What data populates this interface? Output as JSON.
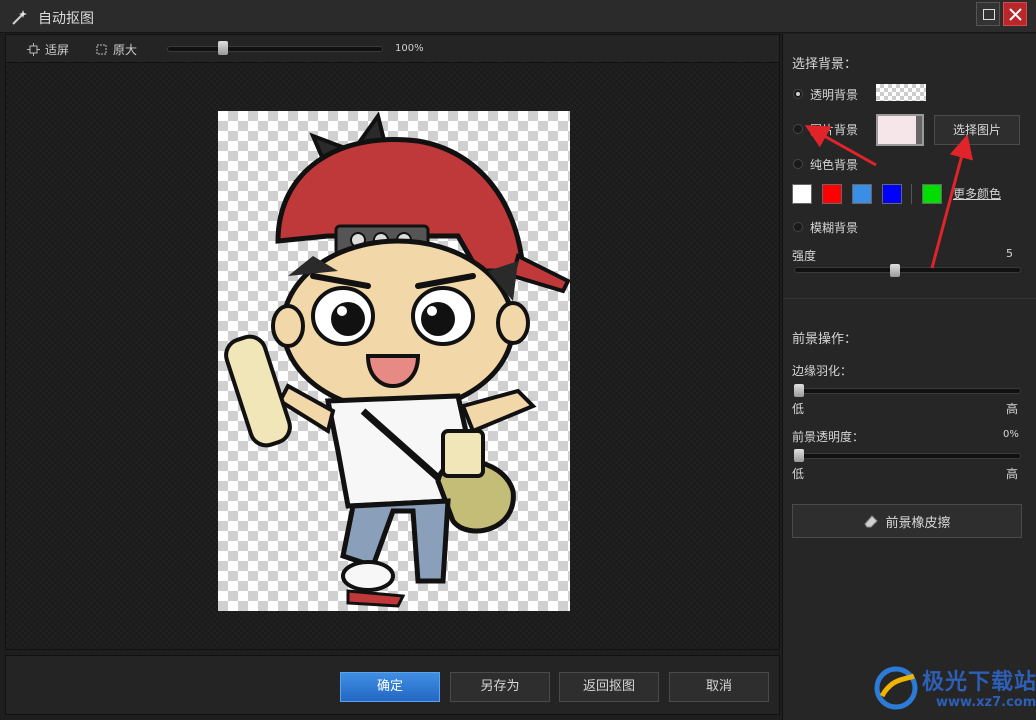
{
  "window": {
    "title": "自动抠图"
  },
  "toolbar": {
    "fit_label": "适屏",
    "original_label": "原大",
    "zoom": "100%"
  },
  "footer": {
    "ok_label": "确定",
    "save_as_label": "另存为",
    "back_label": "返回抠图",
    "cancel_label": "取消"
  },
  "background": {
    "section_title": "选择背景：",
    "transparent_label": "透明背景",
    "image_label": "图片背景",
    "choose_image_label": "选择图片",
    "solid_label": "纯色背景",
    "more_colors_label": "更多颜色",
    "blur_label": "模糊背景",
    "strength_label": "强度",
    "strength_value": "5",
    "selected": "透明背景",
    "swatches": [
      "#ffffff",
      "#ff0000",
      "#3a8ee6",
      "#0000ff",
      "#00dd00"
    ]
  },
  "foreground": {
    "section_title": "前景操作：",
    "feather_label": "边缘羽化：",
    "feather_low": "低",
    "feather_high": "高",
    "opacity_label": "前景透明度：",
    "opacity_value": "0%",
    "opacity_low": "低",
    "opacity_high": "高",
    "eraser_label": "前景橡皮擦"
  },
  "watermark": {
    "name": "极光下载站",
    "url": "www.xz7.com"
  },
  "colors": {
    "accent": "#2d78d6",
    "close": "#b8282b",
    "arrow": "#e0242a"
  }
}
